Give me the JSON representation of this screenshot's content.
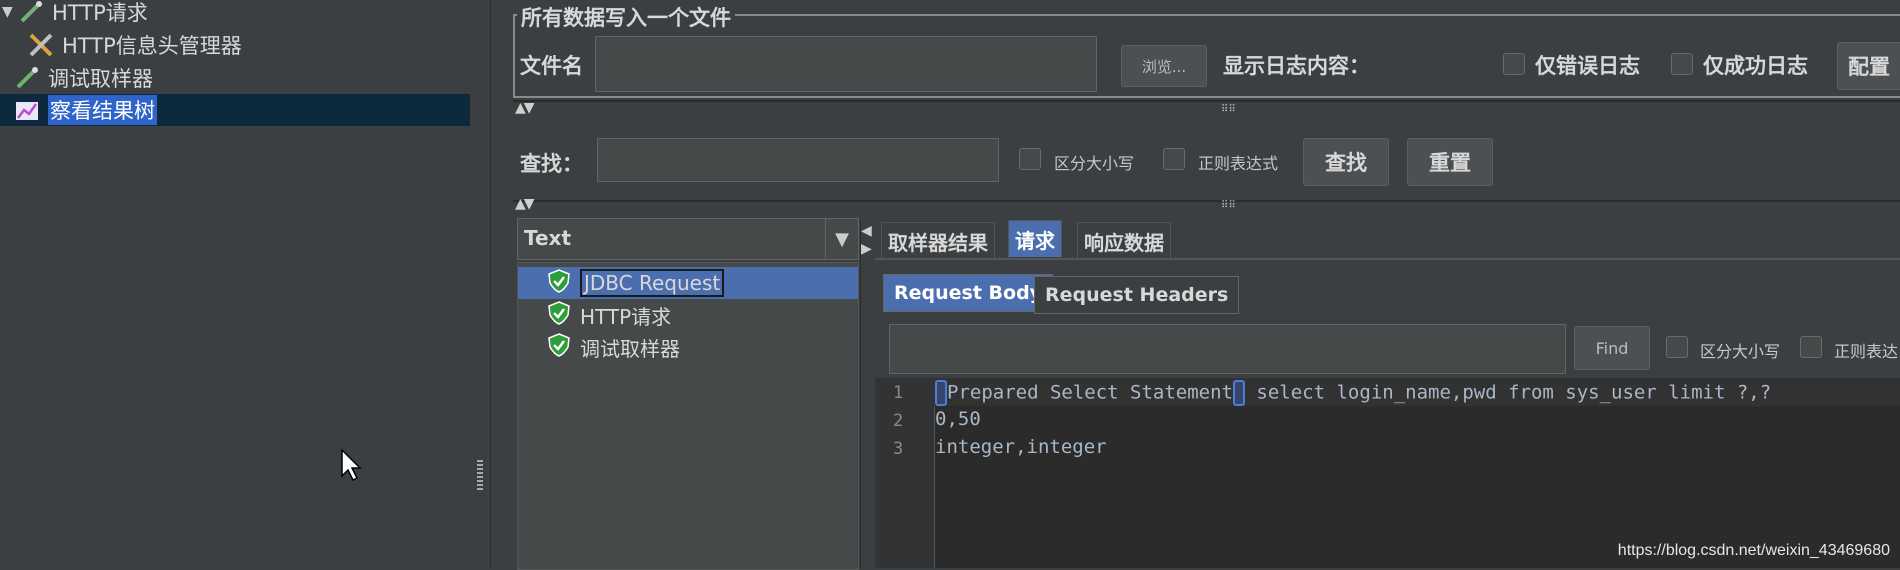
{
  "tree": {
    "items": [
      {
        "label": "HTTP请求",
        "icon": "pipette-icon"
      },
      {
        "label": "HTTP信息头管理器",
        "icon": "tools-icon"
      },
      {
        "label": "调试取样器",
        "icon": "pipette-icon"
      },
      {
        "label": "察看结果树",
        "icon": "chart-icon",
        "selected": true
      }
    ]
  },
  "file_section": {
    "title": "所有数据写入一个文件",
    "filename_label": "文件名",
    "filename_value": "",
    "browse_label": "浏览...",
    "log_label": "显示日志内容：",
    "errors_only_label": "仅错误日志",
    "success_only_label": "仅成功日志",
    "config_label": "配置"
  },
  "search": {
    "label": "查找：",
    "value": "",
    "case_label": "区分大小写",
    "regex_label": "正则表达式",
    "find_label": "查找",
    "reset_label": "重置"
  },
  "results": {
    "renderer_value": "Text",
    "items": [
      {
        "label": "JDBC Request",
        "selected": true
      },
      {
        "label": "HTTP请求"
      },
      {
        "label": "调试取样器"
      }
    ]
  },
  "tabs": [
    {
      "label": "取样器结果"
    },
    {
      "label": "请求",
      "active": true
    },
    {
      "label": "响应数据"
    }
  ],
  "subtabs": [
    {
      "label": "Request Body",
      "active": true
    },
    {
      "label": "Request Headers"
    }
  ],
  "body_search": {
    "value": "",
    "find_label": "Find",
    "case_label": "区分大小写",
    "regex_label": "正则表达"
  },
  "editor": {
    "lines": [
      {
        "num": "1",
        "pre": "",
        "mid": "Prepared Select Statement",
        "post": " select login_name,pwd from sys_user limit ?,?"
      },
      {
        "num": "2",
        "text": "0,50"
      },
      {
        "num": "3",
        "text": "integer,integer"
      }
    ]
  },
  "watermark": "https://blog.csdn.net/weixin_43469680"
}
